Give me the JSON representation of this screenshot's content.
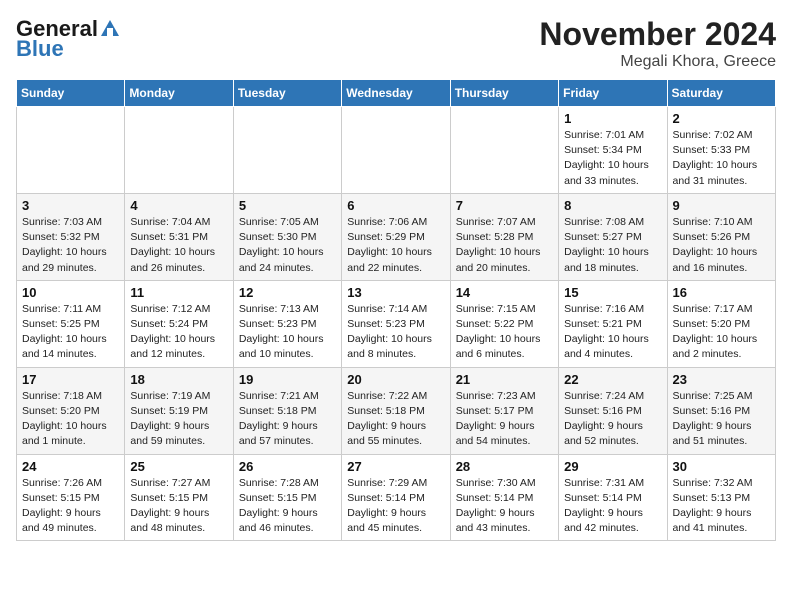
{
  "header": {
    "logo_general": "General",
    "logo_blue": "Blue",
    "title": "November 2024",
    "subtitle": "Megali Khora, Greece"
  },
  "days_of_week": [
    "Sunday",
    "Monday",
    "Tuesday",
    "Wednesday",
    "Thursday",
    "Friday",
    "Saturday"
  ],
  "weeks": [
    [
      {
        "day": "",
        "info": ""
      },
      {
        "day": "",
        "info": ""
      },
      {
        "day": "",
        "info": ""
      },
      {
        "day": "",
        "info": ""
      },
      {
        "day": "",
        "info": ""
      },
      {
        "day": "1",
        "info": "Sunrise: 7:01 AM\nSunset: 5:34 PM\nDaylight: 10 hours\nand 33 minutes."
      },
      {
        "day": "2",
        "info": "Sunrise: 7:02 AM\nSunset: 5:33 PM\nDaylight: 10 hours\nand 31 minutes."
      }
    ],
    [
      {
        "day": "3",
        "info": "Sunrise: 7:03 AM\nSunset: 5:32 PM\nDaylight: 10 hours\nand 29 minutes."
      },
      {
        "day": "4",
        "info": "Sunrise: 7:04 AM\nSunset: 5:31 PM\nDaylight: 10 hours\nand 26 minutes."
      },
      {
        "day": "5",
        "info": "Sunrise: 7:05 AM\nSunset: 5:30 PM\nDaylight: 10 hours\nand 24 minutes."
      },
      {
        "day": "6",
        "info": "Sunrise: 7:06 AM\nSunset: 5:29 PM\nDaylight: 10 hours\nand 22 minutes."
      },
      {
        "day": "7",
        "info": "Sunrise: 7:07 AM\nSunset: 5:28 PM\nDaylight: 10 hours\nand 20 minutes."
      },
      {
        "day": "8",
        "info": "Sunrise: 7:08 AM\nSunset: 5:27 PM\nDaylight: 10 hours\nand 18 minutes."
      },
      {
        "day": "9",
        "info": "Sunrise: 7:10 AM\nSunset: 5:26 PM\nDaylight: 10 hours\nand 16 minutes."
      }
    ],
    [
      {
        "day": "10",
        "info": "Sunrise: 7:11 AM\nSunset: 5:25 PM\nDaylight: 10 hours\nand 14 minutes."
      },
      {
        "day": "11",
        "info": "Sunrise: 7:12 AM\nSunset: 5:24 PM\nDaylight: 10 hours\nand 12 minutes."
      },
      {
        "day": "12",
        "info": "Sunrise: 7:13 AM\nSunset: 5:23 PM\nDaylight: 10 hours\nand 10 minutes."
      },
      {
        "day": "13",
        "info": "Sunrise: 7:14 AM\nSunset: 5:23 PM\nDaylight: 10 hours\nand 8 minutes."
      },
      {
        "day": "14",
        "info": "Sunrise: 7:15 AM\nSunset: 5:22 PM\nDaylight: 10 hours\nand 6 minutes."
      },
      {
        "day": "15",
        "info": "Sunrise: 7:16 AM\nSunset: 5:21 PM\nDaylight: 10 hours\nand 4 minutes."
      },
      {
        "day": "16",
        "info": "Sunrise: 7:17 AM\nSunset: 5:20 PM\nDaylight: 10 hours\nand 2 minutes."
      }
    ],
    [
      {
        "day": "17",
        "info": "Sunrise: 7:18 AM\nSunset: 5:20 PM\nDaylight: 10 hours\nand 1 minute."
      },
      {
        "day": "18",
        "info": "Sunrise: 7:19 AM\nSunset: 5:19 PM\nDaylight: 9 hours\nand 59 minutes."
      },
      {
        "day": "19",
        "info": "Sunrise: 7:21 AM\nSunset: 5:18 PM\nDaylight: 9 hours\nand 57 minutes."
      },
      {
        "day": "20",
        "info": "Sunrise: 7:22 AM\nSunset: 5:18 PM\nDaylight: 9 hours\nand 55 minutes."
      },
      {
        "day": "21",
        "info": "Sunrise: 7:23 AM\nSunset: 5:17 PM\nDaylight: 9 hours\nand 54 minutes."
      },
      {
        "day": "22",
        "info": "Sunrise: 7:24 AM\nSunset: 5:16 PM\nDaylight: 9 hours\nand 52 minutes."
      },
      {
        "day": "23",
        "info": "Sunrise: 7:25 AM\nSunset: 5:16 PM\nDaylight: 9 hours\nand 51 minutes."
      }
    ],
    [
      {
        "day": "24",
        "info": "Sunrise: 7:26 AM\nSunset: 5:15 PM\nDaylight: 9 hours\nand 49 minutes."
      },
      {
        "day": "25",
        "info": "Sunrise: 7:27 AM\nSunset: 5:15 PM\nDaylight: 9 hours\nand 48 minutes."
      },
      {
        "day": "26",
        "info": "Sunrise: 7:28 AM\nSunset: 5:15 PM\nDaylight: 9 hours\nand 46 minutes."
      },
      {
        "day": "27",
        "info": "Sunrise: 7:29 AM\nSunset: 5:14 PM\nDaylight: 9 hours\nand 45 minutes."
      },
      {
        "day": "28",
        "info": "Sunrise: 7:30 AM\nSunset: 5:14 PM\nDaylight: 9 hours\nand 43 minutes."
      },
      {
        "day": "29",
        "info": "Sunrise: 7:31 AM\nSunset: 5:14 PM\nDaylight: 9 hours\nand 42 minutes."
      },
      {
        "day": "30",
        "info": "Sunrise: 7:32 AM\nSunset: 5:13 PM\nDaylight: 9 hours\nand 41 minutes."
      }
    ]
  ]
}
